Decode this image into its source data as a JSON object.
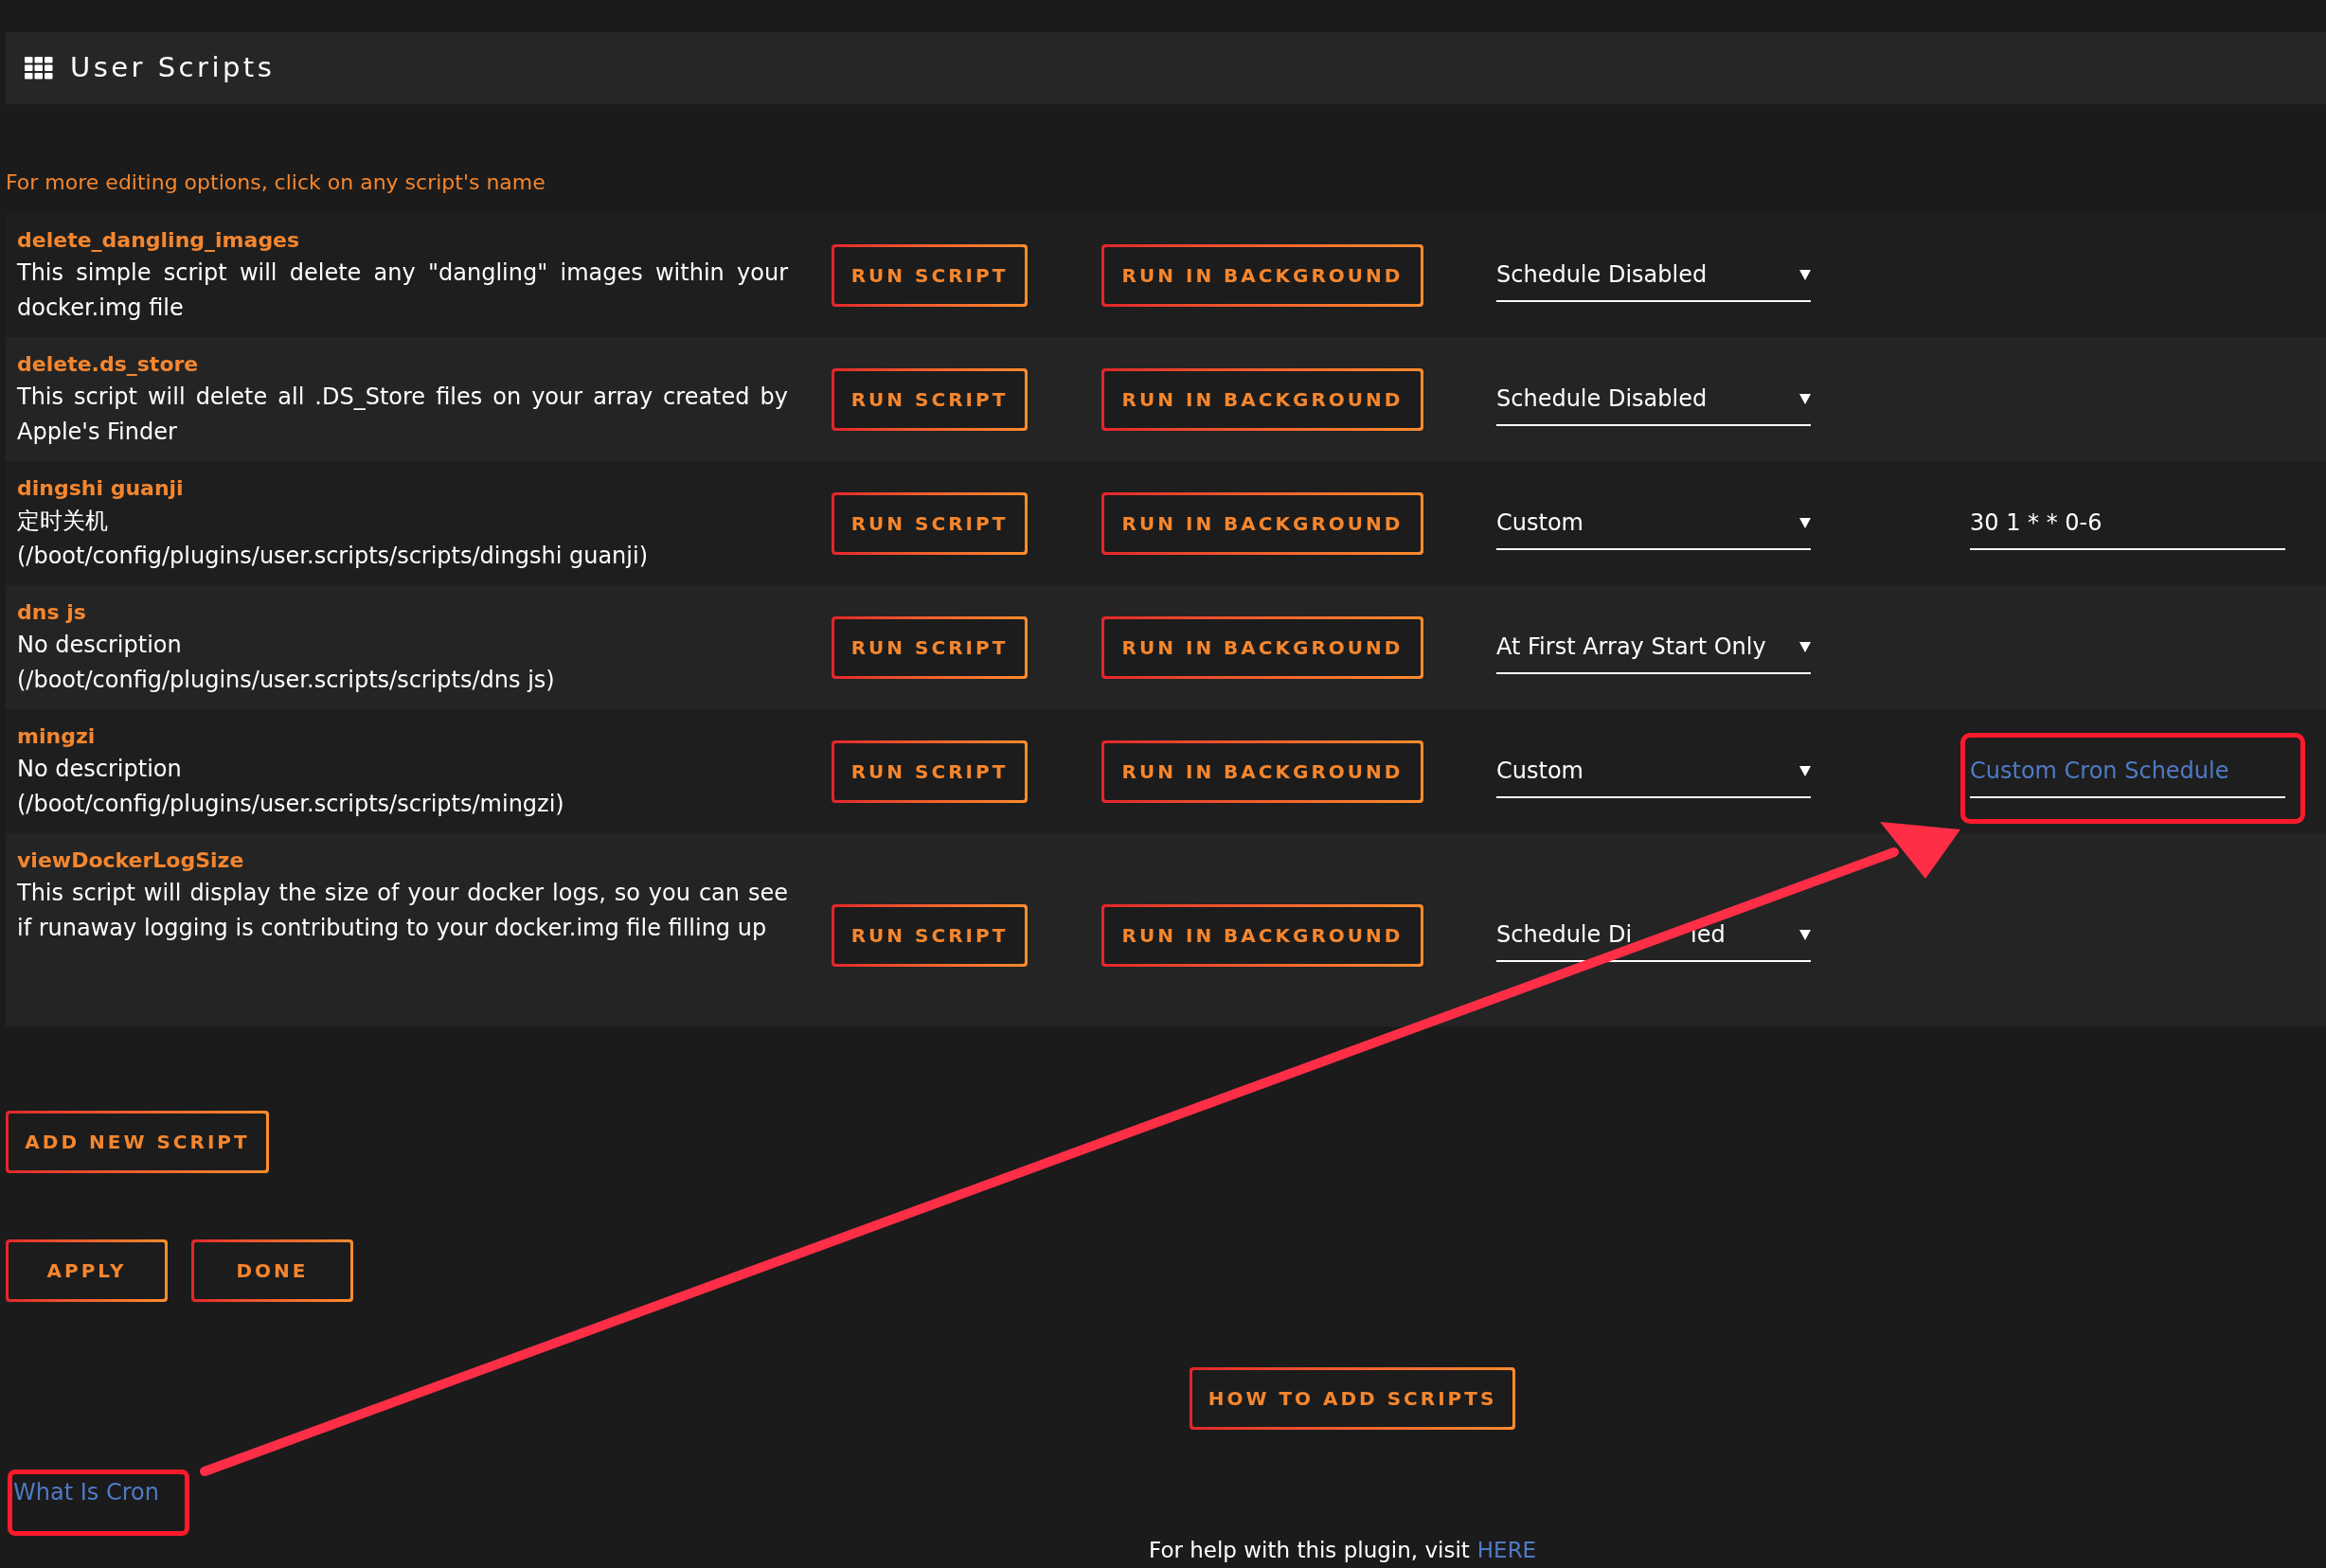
{
  "header": {
    "title": "User Scripts"
  },
  "info": "For more editing options, click on any script's name",
  "scripts": [
    {
      "name": "delete_dangling_images",
      "description": "This simple script will delete any \"dangling\" images within your docker.img file",
      "run_label": "RUN SCRIPT",
      "background_label": "RUN IN BACKGROUND",
      "schedule": "Schedule Disabled"
    },
    {
      "name": "delete.ds_store",
      "description": "This script will delete all .DS_Store files on your array created by Apple's Finder",
      "run_label": "RUN SCRIPT",
      "background_label": "RUN IN BACKGROUND",
      "schedule": "Schedule Disabled"
    },
    {
      "name": "dingshi guanji",
      "description": "定时关机\n(/boot/config/plugins/user.scripts/scripts/dingshi guanji)",
      "run_label": "RUN SCRIPT",
      "background_label": "RUN IN BACKGROUND",
      "schedule": "Custom",
      "cron": {
        "value": "30 1 * * 0-6"
      }
    },
    {
      "name": "dns js",
      "description": "No description\n(/boot/config/plugins/user.scripts/scripts/dns js)",
      "run_label": "RUN SCRIPT",
      "background_label": "RUN IN BACKGROUND",
      "schedule": "At First Array Start Only"
    },
    {
      "name": "mingzi",
      "description": "No description\n(/boot/config/plugins/user.scripts/scripts/mingzi)",
      "run_label": "RUN SCRIPT",
      "background_label": "RUN IN BACKGROUND",
      "schedule": "Custom",
      "cron": {
        "placeholder": "Custom Cron Schedule"
      }
    },
    {
      "name": "viewDockerLogSize",
      "description": "This script will display the size of your docker logs, so you can see if runaway logging is contributing to your docker.img file filling up",
      "run_label": "RUN SCRIPT",
      "background_label": "RUN IN BACKGROUND",
      "schedule": "Schedule Di",
      "schedule_tail": "led"
    }
  ],
  "add_button": "ADD NEW SCRIPT",
  "apply_button": "APPLY",
  "done_button": "DONE",
  "howto_button": "HOW TO ADD SCRIPTS",
  "cron_link": "What Is Cron",
  "help": {
    "text": "For help with this plugin, visit",
    "link": "HERE"
  }
}
